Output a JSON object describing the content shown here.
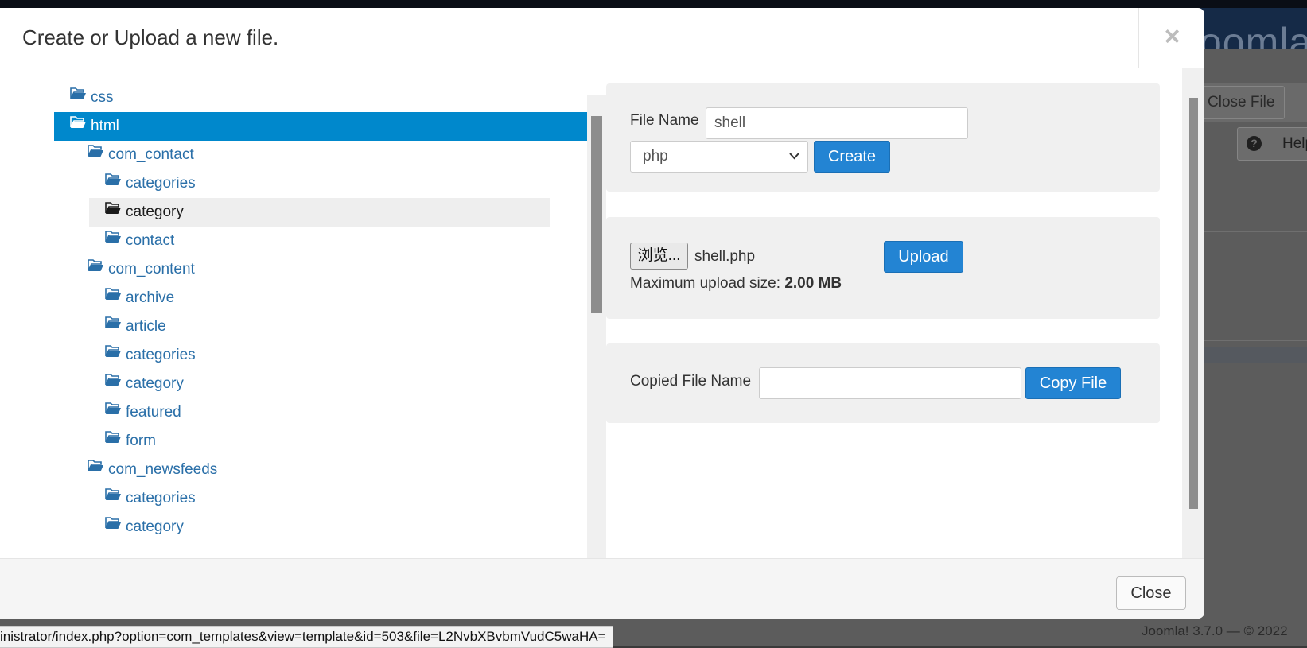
{
  "background": {
    "logo_text": "oomla",
    "close_file_label": "Close File",
    "help_label": "Help",
    "footer_version": "Joomla! 3.7.0 — © 2022"
  },
  "modal": {
    "title": "Create or Upload a new file.",
    "close_x": "×",
    "footer_close": "Close"
  },
  "tree": {
    "items": [
      {
        "label": "css",
        "level": 0
      },
      {
        "label": "html",
        "level": 0,
        "state": "selected"
      },
      {
        "label": "com_contact",
        "level": 1
      },
      {
        "label": "categories",
        "level": 2
      },
      {
        "label": "category",
        "level": 2,
        "state": "hover"
      },
      {
        "label": "contact",
        "level": 2
      },
      {
        "label": "com_content",
        "level": 1
      },
      {
        "label": "archive",
        "level": 2
      },
      {
        "label": "article",
        "level": 2
      },
      {
        "label": "categories",
        "level": 2
      },
      {
        "label": "category",
        "level": 2
      },
      {
        "label": "featured",
        "level": 2
      },
      {
        "label": "form",
        "level": 2
      },
      {
        "label": "com_newsfeeds",
        "level": 1
      },
      {
        "label": "categories",
        "level": 2
      },
      {
        "label": "category",
        "level": 2
      }
    ]
  },
  "create": {
    "file_name_label": "File Name",
    "file_name_value": "shell",
    "extension_selected": "php",
    "create_label": "Create"
  },
  "upload": {
    "browse_label": "浏览...",
    "selected_file": "shell.php",
    "upload_label": "Upload",
    "max_size_label": "Maximum upload size:",
    "max_size_value": "2.00 MB"
  },
  "copy": {
    "copied_name_label": "Copied File Name",
    "copied_name_value": "",
    "copy_label": "Copy File"
  },
  "statusbar": {
    "url": "inistrator/index.php?option=com_templates&view=template&id=503&file=L2NvbXBvbmVudC5waHA="
  },
  "colors": {
    "selected_row": "#0088cc",
    "link": "#2a6fa8",
    "primary_button": "#2384d3",
    "panel_bg": "#f0f0f0"
  }
}
